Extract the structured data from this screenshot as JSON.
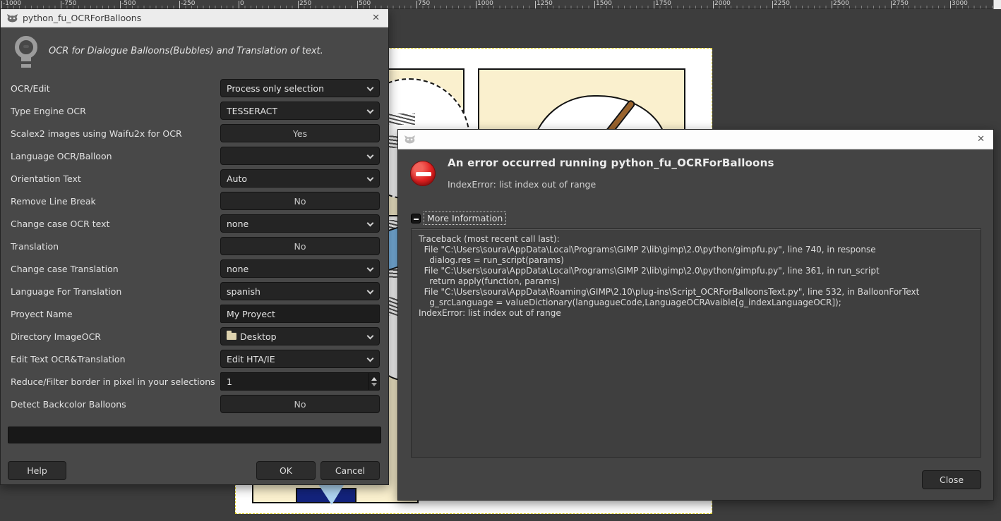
{
  "ruler": {
    "labels": [
      "-1000",
      "-750",
      "-500",
      "-250",
      "0",
      "250",
      "500",
      "750",
      "1000",
      "1250",
      "1500",
      "1750",
      "2000",
      "2250",
      "2500",
      "2750",
      "3000"
    ]
  },
  "plugin_dialog": {
    "title": "python_fu_OCRForBalloons",
    "close_label": "✕",
    "description": "OCR for Dialogue Balloons(Bubbles) and Translation of text.",
    "fields": [
      {
        "label": "OCR/Edit",
        "type": "select",
        "value": "Process only selection"
      },
      {
        "label": "Type Engine OCR",
        "type": "select",
        "value": "TESSERACT"
      },
      {
        "label": "Scalex2 images using Waifu2x for OCR",
        "type": "button",
        "value": "Yes"
      },
      {
        "label": "Language OCR/Balloon",
        "type": "select",
        "value": ""
      },
      {
        "label": "Orientation Text",
        "type": "select",
        "value": "Auto"
      },
      {
        "label": "Remove Line Break",
        "type": "button",
        "value": "No"
      },
      {
        "label": "Change case OCR text",
        "type": "select",
        "value": "none"
      },
      {
        "label": "Translation",
        "type": "button",
        "value": "No"
      },
      {
        "label": "Change case Translation",
        "type": "select",
        "value": "none"
      },
      {
        "label": "Language For Translation",
        "type": "select",
        "value": "spanish"
      },
      {
        "label": "Proyect Name",
        "type": "text",
        "value": "My Proyect"
      },
      {
        "label": "Directory ImageOCR",
        "type": "select",
        "value": "Desktop",
        "icon": "folder"
      },
      {
        "label": "Edit Text OCR&Translation",
        "type": "select",
        "value": "Edit HTA/IE"
      },
      {
        "label": "Reduce/Filter border in pixel in your selections",
        "type": "spin",
        "value": "1"
      },
      {
        "label": "Detect Backcolor Balloons",
        "type": "button",
        "value": "No"
      }
    ],
    "buttons": {
      "help": "Help",
      "ok": "OK",
      "cancel": "Cancel"
    }
  },
  "error_dialog": {
    "close_label": "✕",
    "heading": "An error occurred running python_fu_OCRForBalloons",
    "subheading": "IndexError: list index out of range",
    "expander_label": "More Information",
    "traceback_lines": [
      "Traceback (most recent call last):",
      "  File \"C:\\Users\\soura\\AppData\\Local\\Programs\\GIMP 2\\lib\\gimp\\2.0\\python/gimpfu.py\", line 740, in response",
      "    dialog.res = run_script(params)",
      "  File \"C:\\Users\\soura\\AppData\\Local\\Programs\\GIMP 2\\lib\\gimp\\2.0\\python/gimpfu.py\", line 361, in run_script",
      "    return apply(function, params)",
      "  File \"C:\\Users\\soura\\AppData\\Roaming\\GIMP\\2.10\\plug-ins\\Script_OCRForBalloonsText.py\", line 532, in BalloonForText",
      "    g_srcLanguage = valueDictionary(languagueCode,LanguageOCRAvaible[g_indexLanguageOCR]);",
      "IndexError: list index out of range"
    ],
    "close_button": "Close"
  },
  "colors": {
    "canvas": "#3d3d3d",
    "dialog_body": "#474747",
    "widget_bg": "#242424",
    "selection_dash": "#decf2e",
    "error_red": "#df2020",
    "panel_cream": "#faf0ce"
  }
}
